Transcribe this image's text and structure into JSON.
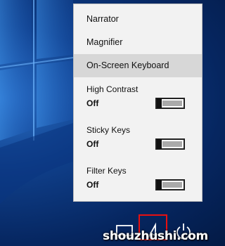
{
  "menu": {
    "items": [
      {
        "label": "Narrator"
      },
      {
        "label": "Magnifier"
      },
      {
        "label": "On-Screen Keyboard"
      }
    ],
    "toggles": [
      {
        "label": "High Contrast",
        "state": "Off"
      },
      {
        "label": "Sticky Keys",
        "state": "Off"
      },
      {
        "label": "Filter Keys",
        "state": "Off"
      }
    ]
  },
  "taskbar": {
    "icons": [
      "desktop-icon",
      "ease-of-access-icon",
      "power-icon"
    ]
  },
  "watermark": "shouzhushi.com",
  "colors": {
    "highlight": "#e81010",
    "menu_bg": "#f2f2f2",
    "selected_bg": "#d7d7d7"
  }
}
